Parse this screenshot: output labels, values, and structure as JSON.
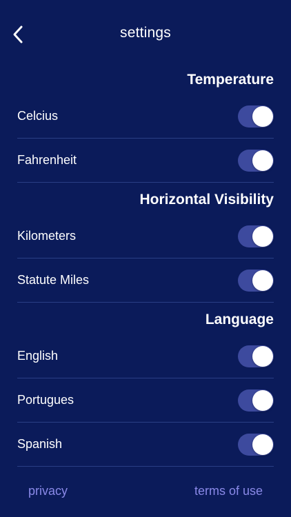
{
  "header": {
    "title": "settings",
    "back_icon": "chevron-left-icon"
  },
  "colors": {
    "background": "#0b1b5a",
    "toggle_track": "#3d4a9e",
    "toggle_knob": "#ffffff",
    "link": "#8a89e8",
    "divider": "#2a3f86"
  },
  "sections": {
    "temperature": {
      "title": "Temperature",
      "items": [
        {
          "label": "Celcius",
          "enabled": true
        },
        {
          "label": "Fahrenheit",
          "enabled": true
        }
      ]
    },
    "visibility": {
      "title": "Horizontal Visibility",
      "items": [
        {
          "label": "Kilometers",
          "enabled": true
        },
        {
          "label": "Statute Miles",
          "enabled": true
        }
      ]
    },
    "language": {
      "title": "Language",
      "items": [
        {
          "label": "English",
          "enabled": true
        },
        {
          "label": "Portugues",
          "enabled": true
        },
        {
          "label": "Spanish",
          "enabled": true
        }
      ]
    }
  },
  "footer": {
    "privacy_label": "privacy",
    "terms_label": "terms of use"
  }
}
